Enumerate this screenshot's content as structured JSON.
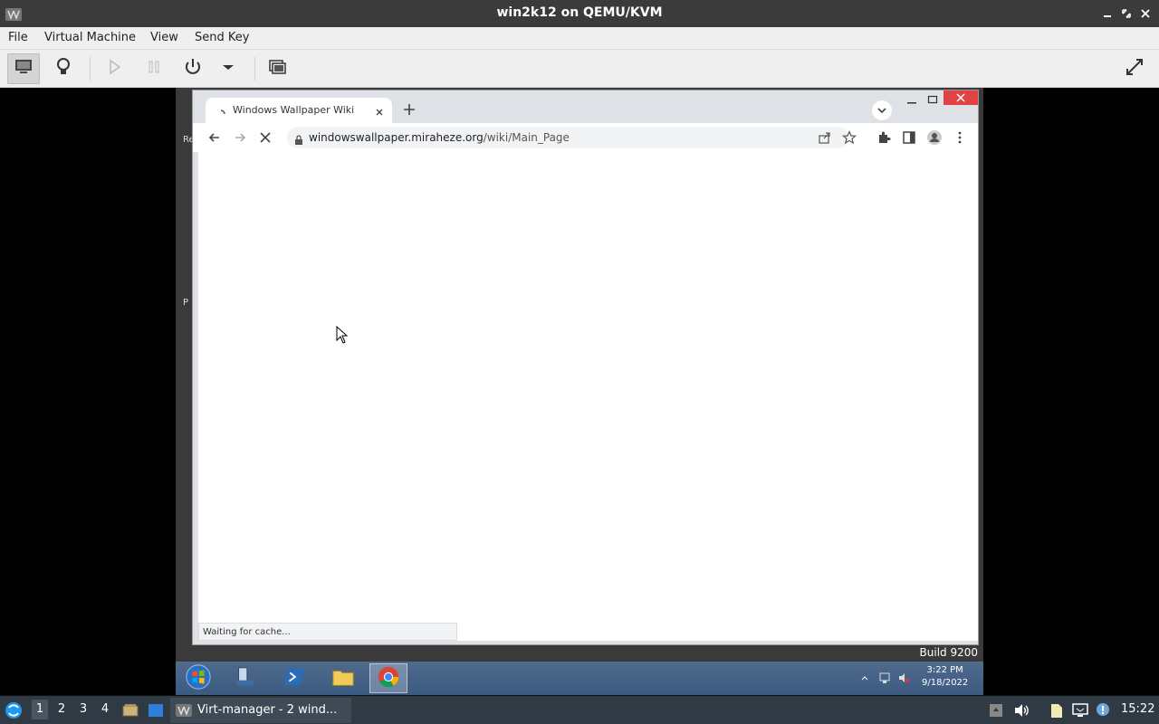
{
  "host_window": {
    "title": "win2k12 on QEMU/KVM"
  },
  "menubar": {
    "items": [
      "File",
      "Virtual Machine",
      "View",
      "Send Key"
    ]
  },
  "guest": {
    "build_text": "Build 9200",
    "desktop_fragments": [
      "Re",
      "P"
    ],
    "taskbar": {
      "time": "3:22 PM",
      "date": "9/18/2022"
    }
  },
  "browser": {
    "tab_title": "Windows Wallpaper Wiki",
    "url_host": "windowswallpaper.miraheze.org",
    "url_path": "/wiki/Main_Page",
    "status_text": "Waiting for cache..."
  },
  "host_panel": {
    "workspaces": [
      "1",
      "2",
      "3",
      "4"
    ],
    "task_label": "Virt-manager - 2 wind...",
    "clock": "15:22"
  },
  "colors": {
    "host_titlebar": "#3b3b3b",
    "chrome_close": "#e04343",
    "guest_taskbar": "#4f6b8e",
    "host_panel": "#2f3a44"
  }
}
